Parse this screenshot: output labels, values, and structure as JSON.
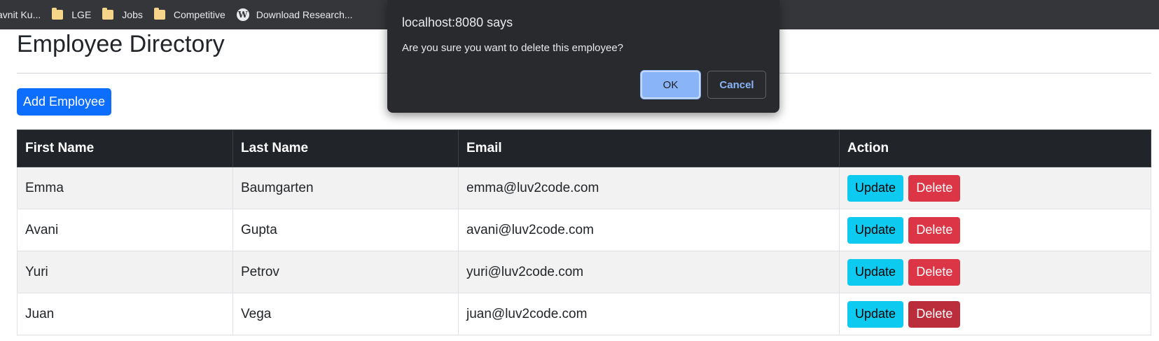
{
  "bookmarks": [
    {
      "label": "avnit Ku...",
      "icon": "none"
    },
    {
      "label": "LGE",
      "icon": "folder-icon"
    },
    {
      "label": "Jobs",
      "icon": "folder-icon"
    },
    {
      "label": "Competitive",
      "icon": "folder-icon"
    },
    {
      "label": "Download Research...",
      "icon": "wordpress-icon"
    }
  ],
  "page": {
    "title": "Employee Directory",
    "add_button": "Add Employee"
  },
  "table": {
    "headers": [
      "First Name",
      "Last Name",
      "Email",
      "Action"
    ],
    "rows": [
      {
        "first": "Emma",
        "last": "Baumgarten",
        "email": "emma@luv2code.com"
      },
      {
        "first": "Avani",
        "last": "Gupta",
        "email": "avani@luv2code.com"
      },
      {
        "first": "Yuri",
        "last": "Petrov",
        "email": "yuri@luv2code.com"
      },
      {
        "first": "Juan",
        "last": "Vega",
        "email": "juan@luv2code.com"
      }
    ],
    "update_label": "Update",
    "delete_label": "Delete"
  },
  "dialog": {
    "title": "localhost:8080 says",
    "message": "Are you sure you want to delete this employee?",
    "ok_label": "OK",
    "cancel_label": "Cancel"
  },
  "colors": {
    "primary": "#0d6efd",
    "info": "#0dcaf0",
    "danger": "#dc3545",
    "table_header": "#212529",
    "dialog_bg": "#292a2d",
    "dialog_accent": "#8ab4f8"
  }
}
